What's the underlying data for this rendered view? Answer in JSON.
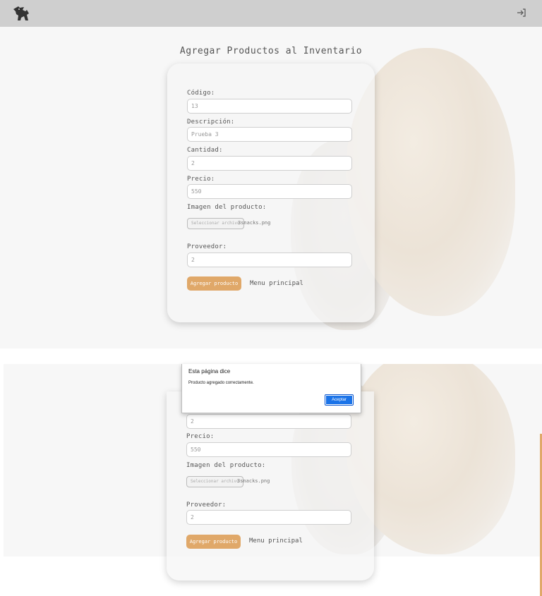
{
  "header": {
    "logo_icon": "dog-cat-logo-icon",
    "logout_icon": "sign-in-arrow-icon"
  },
  "page_title": "Agregar Productos al Inventario",
  "form": {
    "codigo": {
      "label": "Código:",
      "value": "13"
    },
    "descripcion": {
      "label": "Descripción:",
      "value": "Prueba 3"
    },
    "cantidad": {
      "label": "Cantidad:",
      "value": "2"
    },
    "precio": {
      "label": "Precio:",
      "value": "550"
    },
    "imagen": {
      "label": "Imagen del producto:",
      "button": "Seleccionar archivo",
      "filename": "3snacks.png"
    },
    "proveedor": {
      "label": "Proveedor:",
      "value": "2"
    },
    "submit_label": "Agregar producto",
    "menu_link": "Menu principal"
  },
  "dialog": {
    "title": "Esta página dice",
    "message": "Producto agregado correctamente.",
    "ok_label": "Aceptar"
  },
  "colors": {
    "accent": "#e0a869",
    "navbar": "#cfcfcf",
    "dialog_button": "#1a73e8"
  }
}
